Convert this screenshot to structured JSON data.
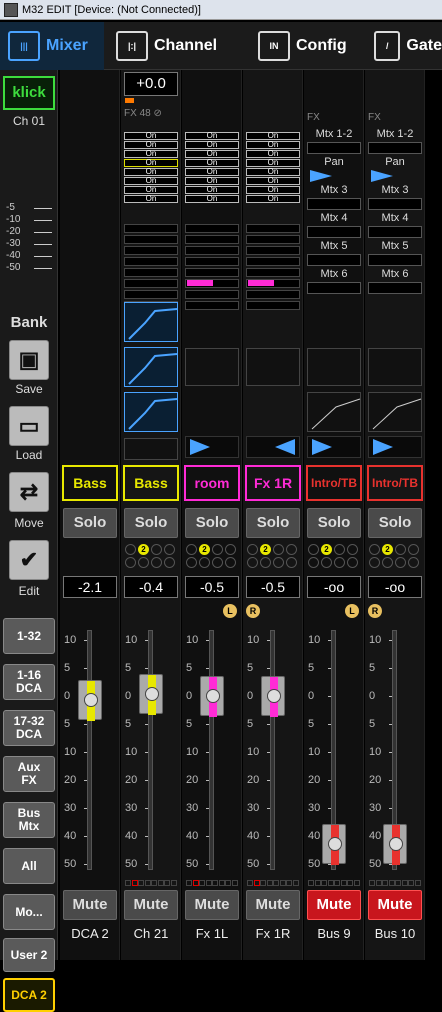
{
  "titlebar": {
    "title": "M32 EDIT [Device: (Not Connected)]"
  },
  "tabs": [
    {
      "label": "Mixer",
      "active": true
    },
    {
      "label": "Channel"
    },
    {
      "label": "Config"
    },
    {
      "label": "Gate"
    }
  ],
  "sidebar": {
    "klick": "klick",
    "channel": "Ch 01",
    "meter_ticks": [
      "-5",
      "-10",
      "-20",
      "-30",
      "-40",
      "-50"
    ],
    "bank": "Bank",
    "save": "Save",
    "load": "Load",
    "move": "Move",
    "edit": "Edit",
    "layers": [
      "1-32",
      "1-16\nDCA",
      "17-32\nDCA",
      "Aux\nFX",
      "Bus\nMtx",
      "All",
      "Mo...",
      "User 2",
      "DCA 2"
    ]
  },
  "top": {
    "gain": "+0.0",
    "fx_label": "FX",
    "fx_num": "48",
    "on": "On",
    "mtx": [
      "Mtx 1-2",
      "Pan",
      "Mtx 3",
      "Mtx 4",
      "Mtx 5",
      "Mtx 6"
    ]
  },
  "strips": [
    {
      "name": "Bass",
      "solo": "Solo",
      "value": "-2.1",
      "mute": "Mute",
      "label": "DCA 2",
      "color": "#e8e800",
      "mute_on": false
    },
    {
      "name": "Bass",
      "solo": "Solo",
      "value": "-0.4",
      "mute": "Mute",
      "label": "Ch 21",
      "color": "#e8e800",
      "mute_on": false
    },
    {
      "name": "room",
      "solo": "Solo",
      "value": "-0.5",
      "mute": "Mute",
      "label": "Fx 1L",
      "color": "#ff2bd6",
      "mute_on": false
    },
    {
      "name": "Fx 1R",
      "solo": "Solo",
      "value": "-0.5",
      "mute": "Mute",
      "label": "Fx 1R",
      "color": "#ff2bd6",
      "mute_on": false
    },
    {
      "name": "Intro/TB",
      "solo": "Solo",
      "value": "-oo",
      "mute": "Mute",
      "label": "Bus 9",
      "color": "#e8322e",
      "mute_on": true
    },
    {
      "name": "Intro/TB",
      "solo": "Solo",
      "value": "-oo",
      "mute": "Mute",
      "label": "Bus 10",
      "color": "#e8322e",
      "mute_on": true
    }
  ],
  "fader_scale": [
    "10",
    "5",
    "0",
    "5",
    "10",
    "20",
    "30",
    "40",
    "50"
  ],
  "lr": {
    "l": "L",
    "r": "R"
  },
  "dot_label": "2"
}
